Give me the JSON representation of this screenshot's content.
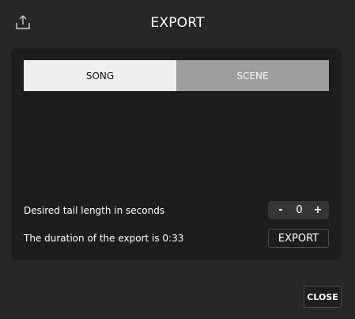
{
  "header": {
    "title": "EXPORT",
    "icon": "upload-icon"
  },
  "tabs": [
    {
      "label": "SONG",
      "active": true
    },
    {
      "label": "SCENE",
      "active": false
    }
  ],
  "tail": {
    "label": "Desired tail length in seconds",
    "decrement": "-",
    "value": "0",
    "increment": "+"
  },
  "duration": {
    "label": "The duration of the export is 0:33"
  },
  "export_button": "EXPORT",
  "close_button": "CLOSE",
  "colors": {
    "background": "#272727",
    "panel": "#1d1d1d",
    "tab_active": "#efefef",
    "tab_inactive": "#9e9e9e"
  }
}
